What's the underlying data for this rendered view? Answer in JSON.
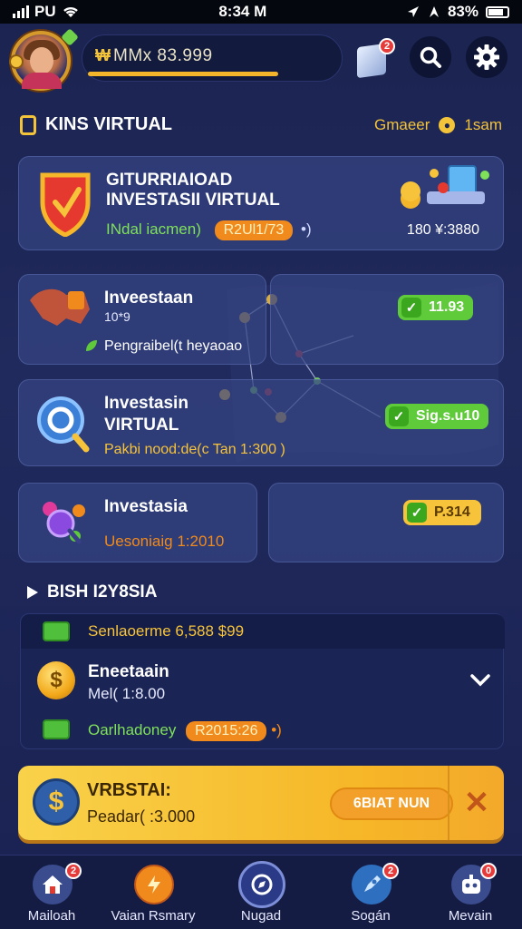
{
  "status_bar": {
    "carrier": "PU",
    "time": "8:34 M",
    "battery": "83%"
  },
  "header": {
    "balance": "MMx 83.999",
    "currency_icon": "₩",
    "box_badge": "2"
  },
  "section": {
    "title": "KINS VIRTUAL",
    "right_label": "Gmaeer",
    "right_value": "1sam"
  },
  "card_main": {
    "title_line1": "GITURRIAIOAD",
    "title_line2": "INVESTASII VIRTUAL",
    "sub_label": "INdal iacmen)",
    "sub_pill": "R2Ul1/73",
    "right_value": "180 ¥:3880"
  },
  "card_2": {
    "title": "Inveestaan",
    "sub": "10*9",
    "note": "Pengraibel(t heyaoao",
    "badge": "11.93"
  },
  "card_3": {
    "title_line1": "Investasin",
    "title_line2": "VIRTUAL",
    "sub": "Pakbi nood:de(c Tan 1:300 )",
    "badge": "Sig.s.u10"
  },
  "card_4": {
    "title": "Investasia",
    "sub": "Uesoniaig 1:2010",
    "badge": "P.314"
  },
  "bottom_section": {
    "title": "BISH I2Y8SIA"
  },
  "list": {
    "top_row": "Senlaoerme 6,588 $99",
    "item_title": "Eneetaain",
    "item_sub": "Mel( 1:8.00",
    "bottom_label": "Oarlhadoney",
    "bottom_pill": "R2015:26"
  },
  "promo": {
    "title": "VRBSTAI:",
    "sub": "Peadar( :3.000",
    "button": "6BIAT NUN",
    "icon": "$"
  },
  "nav": [
    {
      "label": "Mailoah",
      "badge": "2"
    },
    {
      "label": "Vaian Rsmary",
      "badge": ""
    },
    {
      "label": "Nugad",
      "badge": ""
    },
    {
      "label": "Sogán",
      "badge": "2"
    },
    {
      "label": "Mevain",
      "badge": "0"
    }
  ],
  "colors": {
    "background": "#1b2350",
    "accent_gold": "#f3c33a",
    "accent_orange": "#f08a1c",
    "accent_green": "#5fcb3a"
  }
}
